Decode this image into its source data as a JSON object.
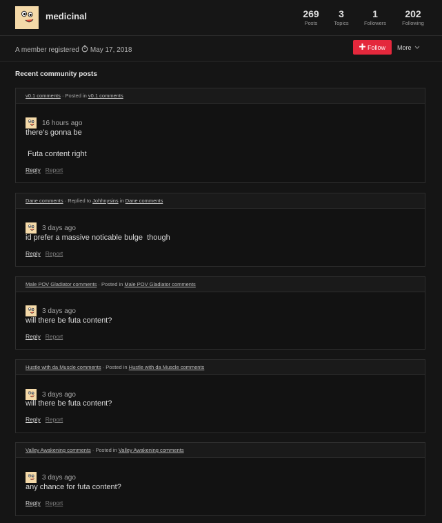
{
  "profile": {
    "username": "medicinal",
    "stats": [
      {
        "value": "269",
        "label": "Posts"
      },
      {
        "value": "3",
        "label": "Topics"
      },
      {
        "value": "1",
        "label": "Followers"
      },
      {
        "value": "202",
        "label": "Following"
      }
    ],
    "member_text": "A member registered",
    "registered_date": "May 17, 2018",
    "follow_label": "Follow",
    "more_label": "More"
  },
  "section_title": "Recent community posts",
  "posts": [
    {
      "head_link": "v0.1 comments",
      "head_action": "· Posted in",
      "head_user": "",
      "head_in": "",
      "head_target": "v0.1 comments",
      "time": "16 hours ago",
      "lines": [
        "there’s gonna be",
        " Futa content right"
      ],
      "reply": "Reply",
      "report": "Report"
    },
    {
      "head_link": "Dane comments",
      "head_action": "· Replied to",
      "head_user": "Johhnysins",
      "head_in": "in",
      "head_target": "Dane comments",
      "time": "3 days ago",
      "lines": [
        "id prefer a massive noticable bulge  though"
      ],
      "reply": "Reply",
      "report": "Report"
    },
    {
      "head_link": "Male POV Gladiator comments",
      "head_action": "· Posted in",
      "head_user": "",
      "head_in": "",
      "head_target": "Male POV Gladiator comments",
      "time": "3 days ago",
      "lines": [
        "will there be futa content?"
      ],
      "reply": "Reply",
      "report": "Report"
    },
    {
      "head_link": "Hustle with da Muscle comments",
      "head_action": "· Posted in",
      "head_user": "",
      "head_in": "",
      "head_target": "Hustle with da Muscle comments",
      "time": "3 days ago",
      "lines": [
        "will there be futa content?"
      ],
      "reply": "Reply",
      "report": "Report"
    },
    {
      "head_link": "Valley Awakening comments",
      "head_action": "· Posted in",
      "head_user": "",
      "head_in": "",
      "head_target": "Valley Awakening comments",
      "time": "3 days ago",
      "lines": [
        "any chance for futa content?"
      ],
      "reply": "Reply",
      "report": "Report"
    }
  ],
  "colors": {
    "accent": "#e4283c",
    "avatar_bg": "#f4d9a8"
  },
  "icons": {
    "avatar": "cartoon-face-avatar",
    "clock": "stopwatch-icon",
    "plus": "plus-icon",
    "chevron": "chevron-down-icon"
  }
}
